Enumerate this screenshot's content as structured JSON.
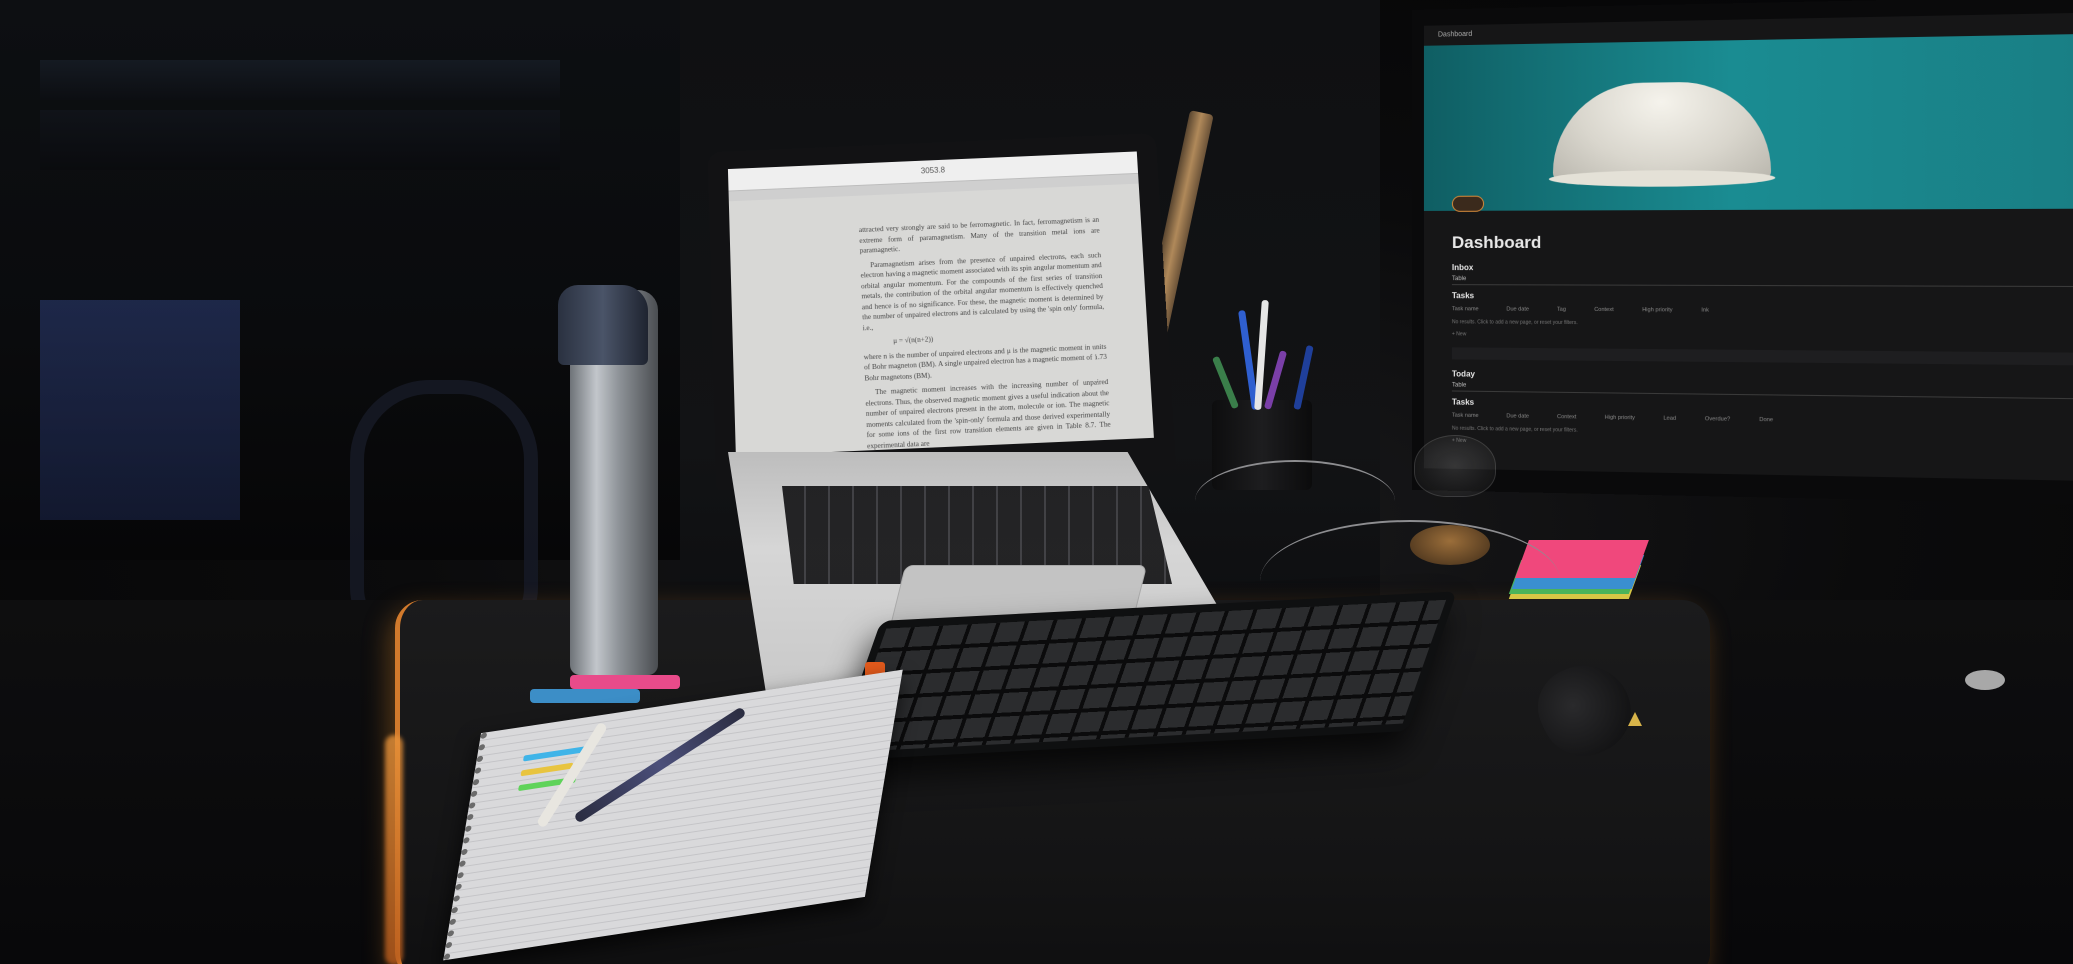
{
  "laptop": {
    "window_title": "3053.8",
    "document_paragraphs": [
      "attracted very strongly are said to be ferromagnetic. In fact, ferromagnetism is an extreme form of paramagnetism. Many of the transition metal ions are paramagnetic.",
      "Paramagnetism arises from the presence of unpaired electrons, each such electron having a magnetic moment associated with its spin angular momentum and orbital angular momentum. For the compounds of the first series of transition metals, the contribution of the orbital angular momentum is effectively quenched and hence is of no significance. For these, the magnetic moment is determined by the number of unpaired electrons and is calculated by using the 'spin only' formula, i.e.,",
      "μ = √(n(n+2))",
      "where n is the number of unpaired electrons and μ is the magnetic moment in units of Bohr magneton (BM). A single unpaired electron has a magnetic moment of 1.73 Bohr magnetons (BM).",
      "The magnetic moment increases with the increasing number of unpaired electrons. Thus, the observed magnetic moment gives a useful indication about the number of unpaired electrons present in the atom, molecule or ion. The magnetic moments calculated from the 'spin-only' formula and those derived experimentally for some ions of the first row transition elements are given in Table 8.7. The experimental data are"
    ]
  },
  "monitor": {
    "breadcrumb": "Dashboard",
    "page_title": "Dashboard",
    "inbox": {
      "heading": "Inbox",
      "view_tab": "Table",
      "db_title": "Tasks",
      "columns": [
        "Task name",
        "Due date",
        "Tag",
        "Context",
        "High priority",
        "Ink"
      ],
      "empty_text": "No results. Click to add a new page, or reset your filters.",
      "new_label": "+ New"
    },
    "today": {
      "heading": "Today",
      "view_tab": "Table",
      "db_title": "Tasks",
      "columns": [
        "Task name",
        "Due date",
        "Context",
        "High priority",
        "Lead",
        "Overdue?",
        "Done"
      ],
      "empty_text": "No results. Click to add a new page, or reset your filters.",
      "new_label": "+ New"
    }
  },
  "colors": {
    "cover_teal": "#1a8c92",
    "mat_glow": "#d27a2c",
    "sticky_pink": "#f0487c",
    "sticky_blue": "#3a8fd0",
    "sticky_green": "#4ab35a",
    "sticky_yellow": "#d6c645",
    "escape_key": "#e25a1c"
  }
}
